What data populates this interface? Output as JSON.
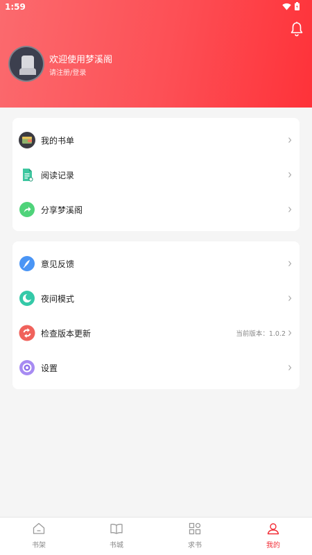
{
  "status": {
    "time": "1:59"
  },
  "header": {
    "welcome": "欢迎使用梦溪阁",
    "login": "请注册/登录"
  },
  "menu_group_1": [
    {
      "label": "我的书单",
      "icon": "book-list-icon"
    },
    {
      "label": "阅读记录",
      "icon": "reading-record-icon"
    },
    {
      "label": "分享梦溪阁",
      "icon": "share-icon"
    }
  ],
  "menu_group_2": [
    {
      "label": "意见反馈",
      "icon": "feedback-icon"
    },
    {
      "label": "夜间模式",
      "icon": "night-mode-icon"
    },
    {
      "label": "检查版本更新",
      "icon": "update-icon",
      "version": "当前版本：1.0.2"
    },
    {
      "label": "设置",
      "icon": "settings-icon"
    }
  ],
  "tabs": [
    {
      "label": "书架",
      "icon": "home-icon"
    },
    {
      "label": "书城",
      "icon": "open-book-icon"
    },
    {
      "label": "求书",
      "icon": "grid-icon"
    },
    {
      "label": "我的",
      "icon": "person-icon",
      "active": true
    }
  ],
  "colors": {
    "accent": "#f22d36",
    "header_start": "#fb6a6e",
    "header_end": "#fe3239"
  }
}
